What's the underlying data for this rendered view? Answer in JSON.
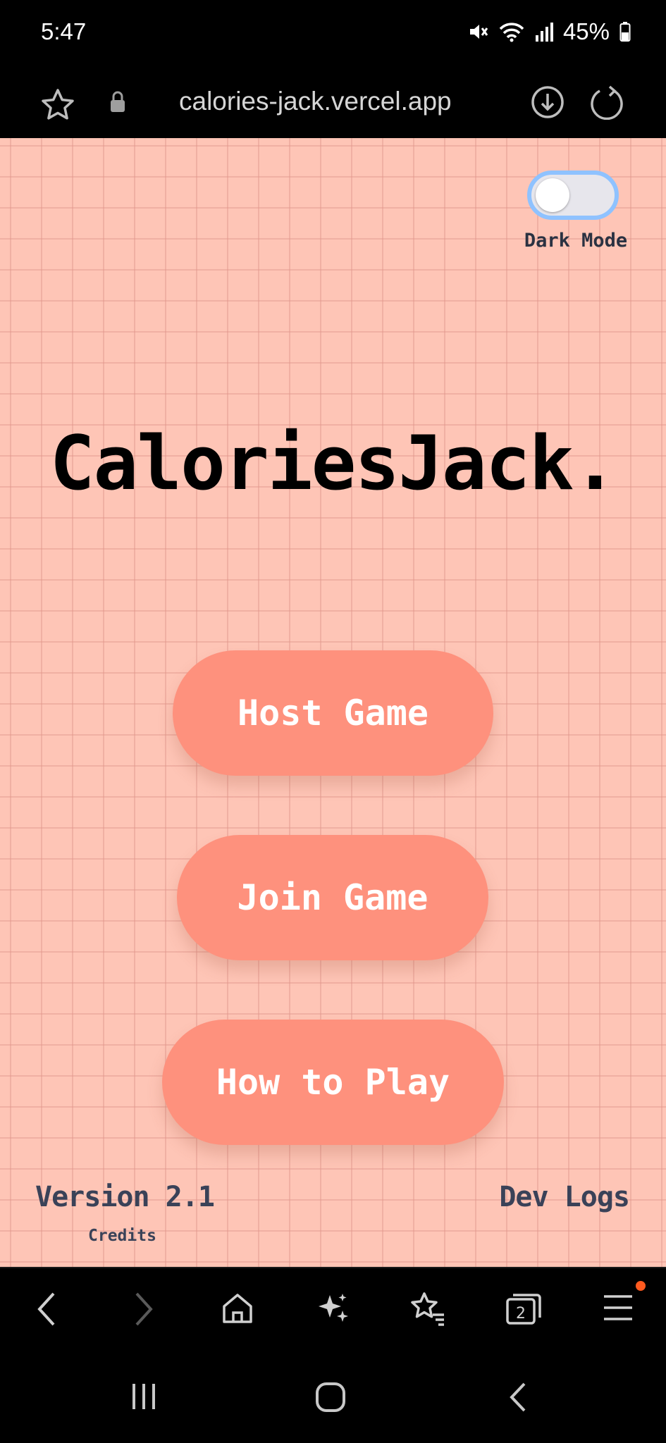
{
  "status_bar": {
    "time": "5:47",
    "battery": "45%"
  },
  "browser": {
    "url": "calories-jack.vercel.app"
  },
  "page": {
    "dark_mode_label": "Dark Mode",
    "dark_mode_on": false,
    "title": "CaloriesJack.",
    "buttons": {
      "host": "Host Game",
      "join": "Join Game",
      "how_to_play": "How to Play"
    },
    "footer": {
      "version": "Version 2.1",
      "credits": "Credits",
      "dev_logs": "Dev Logs"
    }
  },
  "colors": {
    "background": "#fec5b6",
    "button": "#fe917d",
    "toggle_border": "#8fc2ff",
    "footer_text": "#3a4258"
  },
  "bottom_bar": {
    "tabs_count": "2"
  }
}
